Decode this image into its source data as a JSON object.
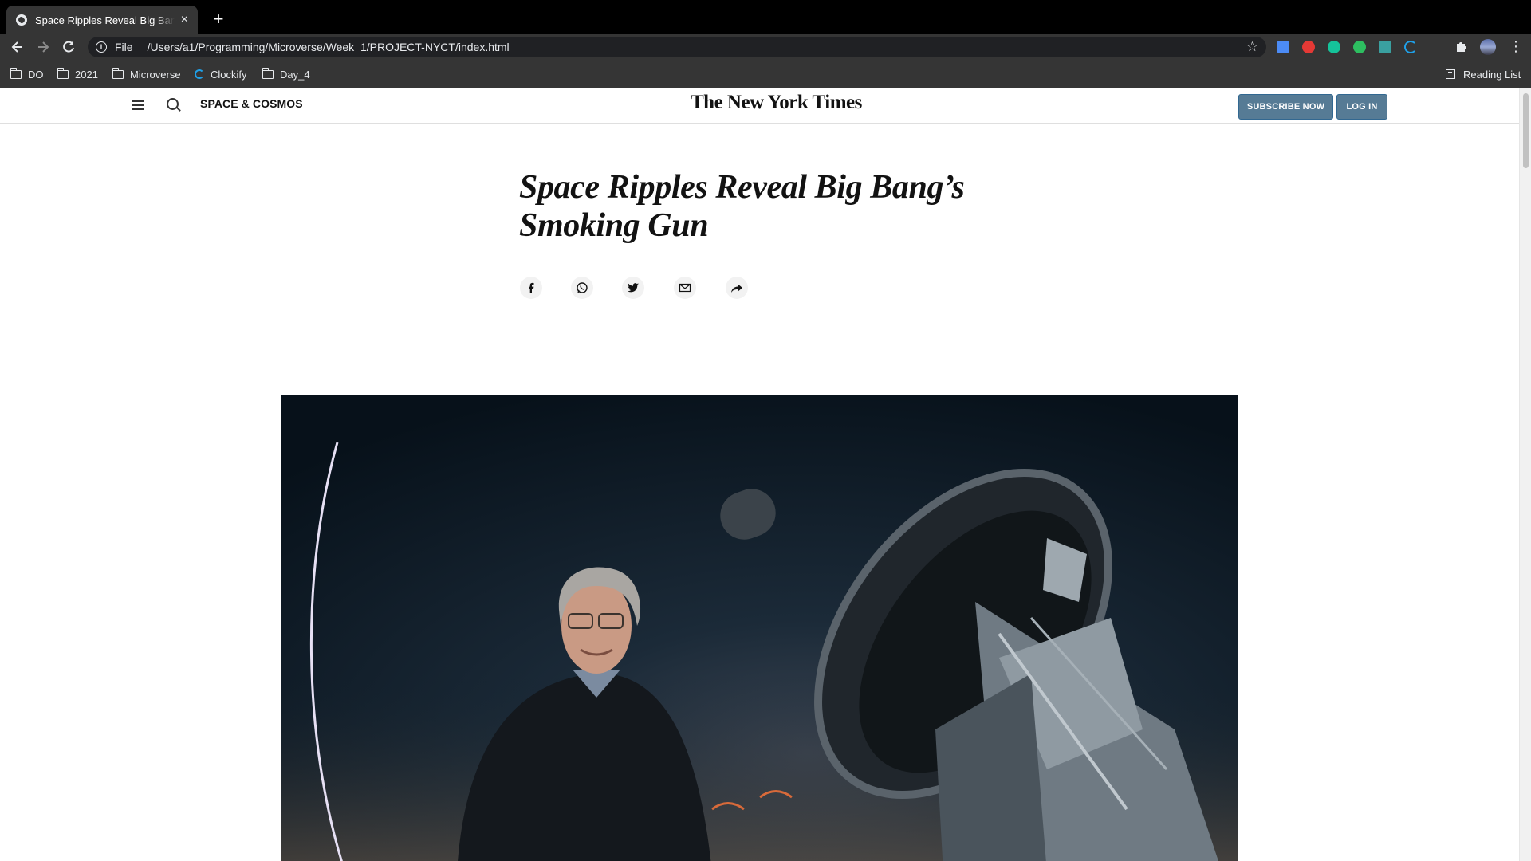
{
  "browser": {
    "tab_title": "Space Ripples Reveal Big Bang's Smoking Gun",
    "tab_close": "×",
    "new_tab": "+",
    "url_scheme": "File",
    "url": "/Users/a1/Programming/Microverse/Week_1/PROJECT-NYCT/index.html",
    "bookmarks": [
      {
        "label": "DO",
        "icon": "folder-icon"
      },
      {
        "label": "2021",
        "icon": "folder-icon"
      },
      {
        "label": "Microverse",
        "icon": "folder-icon"
      },
      {
        "label": "Clockify",
        "icon": "clockify-icon"
      },
      {
        "label": "Day_4",
        "icon": "folder-icon"
      }
    ],
    "reading_list": "Reading List",
    "extension_colors": [
      "#4c8bf5",
      "#e53935",
      "#15c39a",
      "#2dbe60",
      "#3aa0a0",
      "#1fa0e8"
    ]
  },
  "masthead": {
    "section": "SPACE & COSMOS",
    "logo": "The New York Times",
    "subscribe": "SUBSCRIBE NOW",
    "login": "LOG IN",
    "accent_color": "#567b95"
  },
  "article": {
    "headline": "Space Ripples Reveal Big Bang’s Smoking Gun",
    "share_icons": [
      "facebook-icon",
      "whatsapp-icon",
      "twitter-icon",
      "email-icon",
      "share-icon"
    ]
  }
}
